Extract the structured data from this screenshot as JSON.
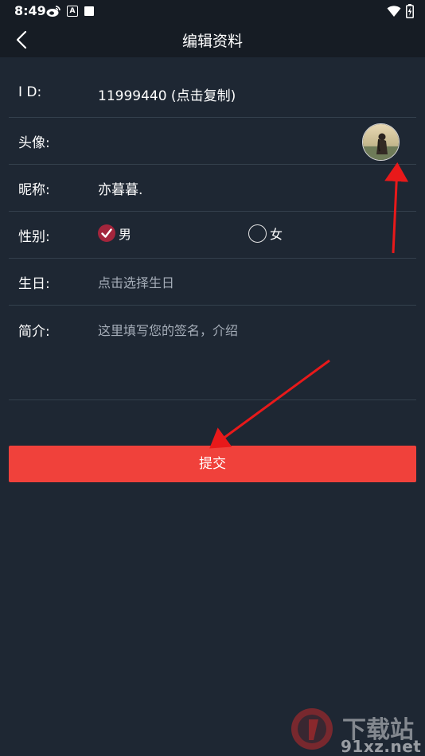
{
  "status_bar": {
    "time": "8:49",
    "left_icons": [
      "weibo-icon",
      "a-square-icon",
      "filled-square-icon"
    ],
    "right_icons": [
      "wifi-icon",
      "battery-charging-icon"
    ]
  },
  "header": {
    "title": "编辑资料",
    "back_icon": "chevron-left-icon"
  },
  "form": {
    "id": {
      "label": "I D:",
      "value": "11999440 (点击复制)"
    },
    "avatar": {
      "label": "头像:"
    },
    "nickname": {
      "label": "昵称:",
      "value": "亦暮暮."
    },
    "gender": {
      "label": "性别:",
      "options": [
        {
          "label": "男",
          "checked": true
        },
        {
          "label": "女",
          "checked": false
        }
      ]
    },
    "birthday": {
      "label": "生日:",
      "placeholder": "点击选择生日"
    },
    "intro": {
      "label": "简介:",
      "placeholder": "这里填写您的签名，介绍"
    }
  },
  "submit": {
    "label": "提交"
  },
  "colors": {
    "background": "#1e2733",
    "header": "#161c24",
    "divider": "#34404d",
    "submit": "#f0413b",
    "checked_radio": "#a3253c",
    "annotation_arrow": "#e8191a"
  },
  "watermark": {
    "text": "下载站",
    "url": "91xz.net"
  }
}
